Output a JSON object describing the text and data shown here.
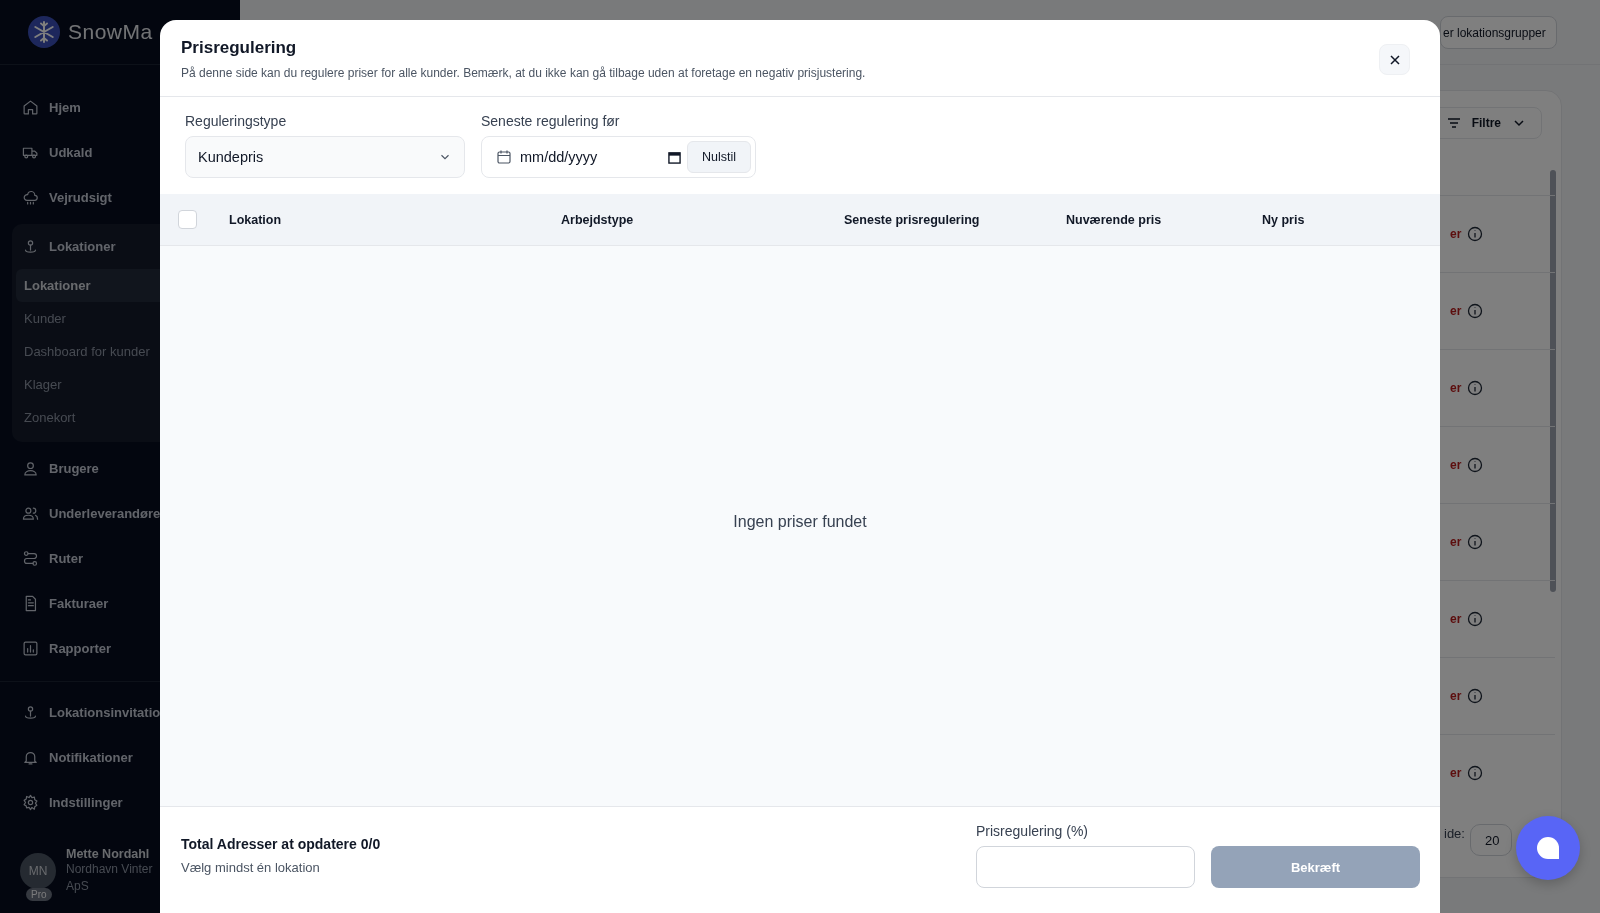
{
  "sidebar": {
    "brand": "SnowMa",
    "items": [
      {
        "label": "Hjem"
      },
      {
        "label": "Udkald"
      },
      {
        "label": "Vejrudsigt"
      },
      {
        "label": "Lokationer",
        "children": [
          {
            "label": "Lokationer",
            "selected": true
          },
          {
            "label": "Kunder",
            "selected": false
          },
          {
            "label": "Dashboard for kunder",
            "selected": false
          },
          {
            "label": "Klager",
            "selected": false
          },
          {
            "label": "Zonekort",
            "selected": false
          }
        ]
      },
      {
        "label": "Brugere"
      },
      {
        "label": "Underleverandøre"
      },
      {
        "label": "Ruter"
      },
      {
        "label": "Fakturaer"
      },
      {
        "label": "Rapporter"
      }
    ],
    "bottom_items": [
      {
        "label": "Lokationsinvitatio"
      },
      {
        "label": "Notifikationer"
      },
      {
        "label": "Indstillinger"
      }
    ],
    "user": {
      "initials": "MN",
      "badge": "Pro",
      "name": "Mette Nordahl",
      "company": "Nordhavn Vinter ApS"
    }
  },
  "background": {
    "top_button": "er lokationsgrupper",
    "filter_button": "Filtre",
    "rows": [
      {
        "status": "er"
      },
      {
        "status": "er"
      },
      {
        "status": "er"
      },
      {
        "status": "er"
      },
      {
        "status": "er"
      },
      {
        "status": "er"
      },
      {
        "status": "er"
      },
      {
        "status": "er"
      }
    ],
    "pagination": {
      "label": "ide:",
      "value": "20"
    }
  },
  "modal": {
    "title": "Prisregulering",
    "description": "På denne side kan du regulere priser for alle kunder. Bemærk, at du ikke kan gå tilbage uden at foretage en negativ prisjustering.",
    "type_field": {
      "label": "Reguleringstype",
      "value": "Kundepris"
    },
    "date_field": {
      "label": "Seneste regulering før",
      "placeholder": "mm/dd/yyyy",
      "reset_button": "Nulstil"
    },
    "table": {
      "select_all": {
        "checked": false
      },
      "columns": [
        "Lokation",
        "Arbejdstype",
        "Seneste prisregulering",
        "Nuværende pris",
        "Ny pris"
      ],
      "empty_text": "Ingen priser fundet"
    },
    "footer": {
      "total": "Total Adresser at opdatere 0/0",
      "hint": "Vælg mindst én lokation",
      "percent_label": "Prisregulering (%)",
      "confirm_button": {
        "label": "Bekræft",
        "disabled": true
      }
    }
  }
}
